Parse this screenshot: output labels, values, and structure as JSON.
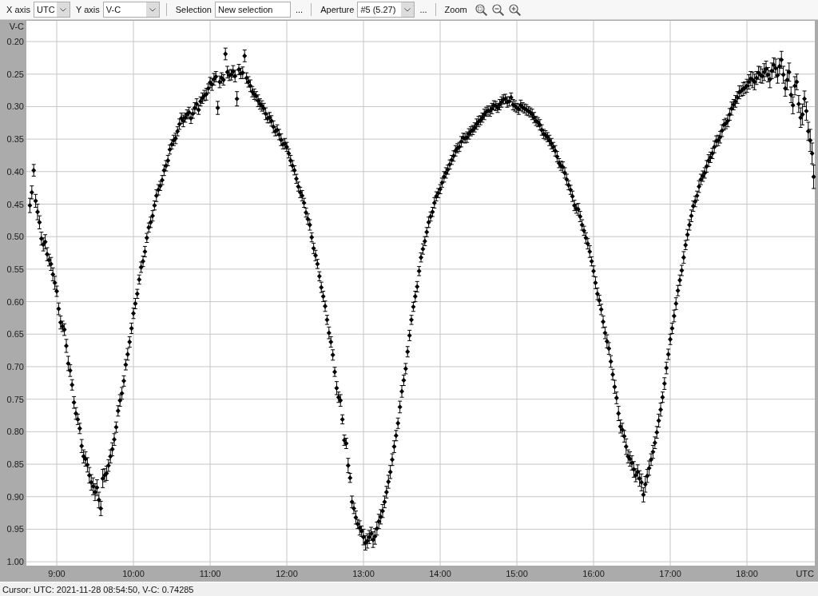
{
  "toolbar": {
    "groups": [
      [
        {
          "kind": "dropdown",
          "label": "X axis",
          "value": "UTC"
        },
        {
          "kind": "dropdown",
          "label": "Y axis",
          "value": "V-C"
        }
      ],
      [
        {
          "kind": "field",
          "label": "Selection",
          "value": "New selection",
          "button": "..."
        }
      ],
      [
        {
          "kind": "dropdown",
          "label": "Aperture",
          "value": "#5 (5.27)",
          "button": "..."
        }
      ],
      [
        {
          "kind": "zoom",
          "label": "Zoom"
        }
      ]
    ]
  },
  "chart": {
    "chart_data": {
      "type": "scatter",
      "grid": true,
      "xlabel": "UTC",
      "ylabel": "V-C",
      "xlim": [
        8.604,
        18.885
      ],
      "ylim": [
        1.006,
        0.168
      ],
      "xticks": [
        {
          "value": 9,
          "label": "9:00"
        },
        {
          "value": 10,
          "label": "10:00"
        },
        {
          "value": 11,
          "label": "11:00"
        },
        {
          "value": 12,
          "label": "12:00"
        },
        {
          "value": 13,
          "label": "13:00"
        },
        {
          "value": 14,
          "label": "14:00"
        },
        {
          "value": 15,
          "label": "15:00"
        },
        {
          "value": 16,
          "label": "16:00"
        },
        {
          "value": 17,
          "label": "17:00"
        },
        {
          "value": 18,
          "label": "18:00"
        }
      ],
      "yticks": [
        {
          "value": 0.2,
          "label": "0.20"
        },
        {
          "value": 0.25,
          "label": "0.25"
        },
        {
          "value": 0.3,
          "label": "0.30"
        },
        {
          "value": 0.35,
          "label": "0.35"
        },
        {
          "value": 0.4,
          "label": "0.40"
        },
        {
          "value": 0.45,
          "label": "0.45"
        },
        {
          "value": 0.5,
          "label": "0.50"
        },
        {
          "value": 0.55,
          "label": "0.55"
        },
        {
          "value": 0.6,
          "label": "0.60"
        },
        {
          "value": 0.65,
          "label": "0.65"
        },
        {
          "value": 0.7,
          "label": "0.70"
        },
        {
          "value": 0.75,
          "label": "0.75"
        },
        {
          "value": 0.8,
          "label": "0.80"
        },
        {
          "value": 0.85,
          "label": "0.85"
        },
        {
          "value": 0.9,
          "label": "0.90"
        },
        {
          "value": 0.95,
          "label": "0.95"
        },
        {
          "value": 1.0,
          "label": "1.00"
        }
      ],
      "x": [
        8.65,
        8.7,
        8.75,
        8.8,
        8.85,
        8.9,
        8.95,
        9,
        9.05,
        9.1,
        9.15,
        9.2,
        9.25,
        9.3,
        9.35,
        9.4,
        9.45,
        9.5,
        9.55,
        9.6,
        9.65,
        9.7,
        9.75,
        9.8,
        9.85,
        9.9,
        9.95,
        10,
        10.05,
        10.1,
        10.15,
        10.2,
        10.25,
        10.3,
        10.35,
        10.4,
        10.45,
        10.5,
        10.55,
        10.6,
        10.65,
        10.7,
        10.75,
        10.8,
        10.85,
        10.9,
        10.95,
        11,
        11.05,
        11.1,
        11.15,
        11.2,
        11.25,
        11.3,
        11.35,
        11.4,
        11.45,
        11.5,
        11.55,
        11.6,
        11.65,
        11.7,
        11.75,
        11.8,
        11.85,
        11.9,
        11.95,
        12,
        12.05,
        12.1,
        12.15,
        12.2,
        12.25,
        12.3,
        12.35,
        12.4,
        12.45,
        12.5,
        12.55,
        12.6,
        12.65,
        12.7,
        12.75,
        12.8,
        12.85,
        12.9,
        12.95,
        13,
        13.05,
        13.1,
        13.15,
        13.2,
        13.25,
        13.3,
        13.35,
        13.4,
        13.45,
        13.5,
        13.55,
        13.6,
        13.65,
        13.7,
        13.75,
        13.8,
        13.85,
        13.9,
        13.95,
        14,
        14.05,
        14.1,
        14.15,
        14.2,
        14.25,
        14.3,
        14.35,
        14.4,
        14.45,
        14.5,
        14.55,
        14.6,
        14.65,
        14.7,
        14.75,
        14.8,
        14.85,
        14.9,
        14.95,
        15,
        15.05,
        15.1,
        15.15,
        15.2,
        15.25,
        15.3,
        15.35,
        15.4,
        15.45,
        15.5,
        15.55,
        15.6,
        15.65,
        15.7,
        15.75,
        15.8,
        15.85,
        15.9,
        15.95,
        16,
        16.05,
        16.1,
        16.15,
        16.2,
        16.25,
        16.3,
        16.35,
        16.4,
        16.45,
        16.5,
        16.55,
        16.6,
        16.65,
        16.7,
        16.75,
        16.8,
        16.85,
        16.9,
        16.95,
        17,
        17.05,
        17.1,
        17.15,
        17.2,
        17.25,
        17.3,
        17.35,
        17.4,
        17.45,
        17.5,
        17.55,
        17.6,
        17.65,
        17.7,
        17.75,
        17.8,
        17.85,
        17.9,
        17.95,
        18,
        18.05,
        18.1,
        18.15,
        18.2,
        18.25,
        18.3,
        18.35,
        18.4,
        18.45,
        18.5,
        18.55,
        18.6,
        18.65,
        18.7,
        18.75,
        18.8,
        18.85,
        18.87,
        8.675,
        8.725,
        8.775,
        8.825,
        8.875,
        8.925,
        8.975,
        9.025,
        9.075,
        9.125,
        9.175,
        9.225,
        9.275,
        9.325,
        9.375,
        9.425,
        9.475,
        9.525,
        9.575,
        9.625,
        9.675,
        9.725,
        9.775,
        9.825,
        9.875,
        9.925,
        9.975,
        10.025,
        10.075,
        10.125,
        10.175,
        10.225,
        10.275,
        10.325,
        10.375,
        10.425,
        10.475,
        10.525,
        10.575,
        10.625,
        10.675,
        10.725,
        10.775,
        10.825,
        10.875,
        10.925,
        10.975,
        11.025,
        11.075,
        11.125,
        11.175,
        11.225,
        11.275,
        11.325,
        11.375,
        11.425,
        11.475,
        11.525,
        11.575,
        11.625,
        11.675,
        11.725,
        11.775,
        11.825,
        11.875,
        11.925,
        11.975,
        12.025,
        12.075,
        12.125,
        12.175,
        12.225,
        12.275,
        12.325,
        12.375,
        12.425,
        12.475,
        12.525,
        12.575,
        12.625,
        12.675,
        12.725,
        12.775,
        12.825,
        12.875,
        12.925,
        12.975,
        13.025,
        13.075,
        13.125,
        13.175,
        13.225,
        13.275,
        13.325,
        13.375,
        13.425,
        13.475,
        13.525,
        13.575,
        13.625,
        13.675,
        13.725,
        13.775,
        13.825,
        13.875,
        13.925,
        13.975,
        14.025,
        14.075,
        14.125,
        14.175,
        14.225,
        14.275,
        14.325,
        14.375,
        14.425,
        14.475,
        14.525,
        14.575,
        14.625,
        14.675,
        14.725,
        14.775,
        14.825,
        14.875,
        14.925,
        14.975,
        15.025,
        15.075,
        15.125,
        15.175,
        15.225,
        15.275,
        15.325,
        15.375,
        15.425,
        15.475,
        15.525,
        15.575,
        15.625,
        15.675,
        15.725,
        15.775,
        15.825,
        15.875,
        15.925,
        15.975,
        16.025,
        16.075,
        16.125,
        16.175,
        16.225,
        16.275,
        16.325,
        16.375,
        16.425,
        16.475,
        16.525,
        16.575,
        16.625,
        16.675,
        16.725,
        16.775,
        16.825,
        16.875,
        16.925,
        16.975,
        17.025,
        17.075,
        17.125,
        17.175,
        17.225,
        17.275,
        17.325,
        17.375,
        17.425,
        17.475,
        17.525,
        17.575,
        17.625,
        17.675,
        17.725,
        17.775,
        17.825,
        17.875,
        17.925,
        17.975,
        18.025,
        18.075,
        18.125,
        18.175,
        18.225,
        18.275,
        18.325,
        18.375,
        18.425,
        18.475,
        18.525,
        18.575,
        18.625,
        18.675,
        18.725,
        18.775,
        18.825
      ],
      "series": [
        {
          "color": "#000000",
          "values": [
            0.452,
            0.398,
            0.462,
            0.503,
            0.508,
            0.536,
            0.558,
            0.584,
            0.632,
            0.643,
            0.695,
            0.728,
            0.772,
            0.795,
            0.838,
            0.851,
            0.878,
            0.893,
            0.905,
            0.872,
            0.864,
            0.838,
            0.812,
            0.768,
            0.741,
            0.697,
            0.662,
            0.618,
            0.588,
            0.547,
            0.523,
            0.486,
            0.468,
            0.437,
            0.422,
            0.398,
            0.383,
            0.358,
            0.349,
            0.327,
            0.322,
            0.312,
            0.318,
            0.302,
            0.305,
            0.287,
            0.281,
            0.263,
            0.258,
            0.302,
            0.256,
            0.219,
            0.252,
            0.246,
            0.288,
            0.249,
            0.222,
            0.262,
            0.277,
            0.284,
            0.296,
            0.303,
            0.318,
            0.322,
            0.338,
            0.343,
            0.358,
            0.362,
            0.383,
            0.398,
            0.423,
            0.437,
            0.463,
            0.482,
            0.518,
            0.542,
            0.578,
            0.607,
            0.648,
            0.682,
            0.733,
            0.752,
            0.813,
            0.852,
            0.908,
            0.932,
            0.948,
            0.962,
            0.968,
            0.957,
            0.961,
            0.938,
            0.922,
            0.893,
            0.862,
            0.823,
            0.787,
            0.738,
            0.703,
            0.652,
            0.608,
            0.577,
            0.532,
            0.507,
            0.478,
            0.462,
            0.438,
            0.427,
            0.408,
            0.397,
            0.382,
            0.368,
            0.362,
            0.348,
            0.347,
            0.338,
            0.332,
            0.323,
            0.317,
            0.308,
            0.307,
            0.298,
            0.302,
            0.293,
            0.288,
            0.292,
            0.297,
            0.302,
            0.298,
            0.303,
            0.307,
            0.312,
            0.322,
            0.328,
            0.342,
            0.347,
            0.357,
            0.368,
            0.387,
            0.393,
            0.412,
            0.428,
            0.452,
            0.458,
            0.482,
            0.502,
            0.523,
            0.553,
            0.588,
            0.612,
            0.648,
            0.672,
            0.712,
            0.748,
            0.792,
            0.807,
            0.838,
            0.848,
            0.867,
            0.872,
            0.897,
            0.868,
            0.843,
            0.817,
            0.783,
            0.747,
            0.702,
            0.658,
            0.622,
            0.583,
            0.552,
            0.513,
            0.482,
            0.453,
            0.437,
            0.412,
            0.402,
            0.383,
            0.372,
            0.353,
            0.347,
            0.328,
            0.322,
            0.303,
            0.292,
            0.278,
            0.273,
            0.268,
            0.257,
            0.262,
            0.248,
            0.253,
            0.242,
            0.258,
            0.236,
            0.252,
            0.228,
            0.272,
            0.247,
            0.298,
            0.262,
            0.317,
            0.288,
            0.338,
            0.372,
            0.408,
            0.432,
            0.445,
            0.478,
            0.512,
            0.527,
            0.542,
            0.571,
            0.611,
            0.638,
            0.668,
            0.706,
            0.755,
            0.781,
            0.822,
            0.842,
            0.867,
            0.884,
            0.886,
            0.918,
            0.867,
            0.852,
            0.827,
            0.793,
            0.752,
            0.722,
            0.681,
            0.641,
            0.603,
            0.566,
            0.538,
            0.502,
            0.478,
            0.452,
            0.428,
            0.413,
            0.391,
            0.366,
            0.352,
            0.338,
            0.318,
            0.317,
            0.309,
            0.311,
            0.296,
            0.292,
            0.283,
            0.272,
            0.266,
            0.254,
            0.262,
            0.259,
            0.247,
            0.251,
            0.253,
            0.243,
            0.248,
            0.256,
            0.268,
            0.281,
            0.291,
            0.299,
            0.311,
            0.317,
            0.331,
            0.336,
            0.351,
            0.357,
            0.372,
            0.391,
            0.411,
            0.432,
            0.448,
            0.473,
            0.501,
            0.529,
            0.561,
            0.592,
            0.628,
            0.662,
            0.708,
            0.747,
            0.781,
            0.818,
            0.871,
            0.918,
            0.942,
            0.953,
            0.971,
            0.962,
            0.966,
            0.949,
            0.931,
            0.908,
            0.877,
            0.843,
            0.806,
            0.762,
            0.721,
            0.677,
            0.628,
            0.592,
            0.553,
            0.519,
            0.493,
            0.469,
            0.448,
            0.433,
            0.417,
            0.402,
            0.389,
            0.376,
            0.364,
            0.354,
            0.349,
            0.342,
            0.336,
            0.327,
            0.321,
            0.312,
            0.306,
            0.303,
            0.299,
            0.297,
            0.289,
            0.293,
            0.286,
            0.299,
            0.304,
            0.301,
            0.305,
            0.309,
            0.317,
            0.324,
            0.336,
            0.344,
            0.352,
            0.362,
            0.377,
            0.391,
            0.402,
            0.421,
            0.438,
            0.457,
            0.469,
            0.491,
            0.511,
            0.538,
            0.571,
            0.598,
            0.631,
            0.661,
            0.692,
            0.731,
            0.772,
            0.797,
            0.823,
            0.842,
            0.858,
            0.862,
            0.878,
            0.881,
            0.856,
            0.831,
            0.801,
            0.766,
            0.726,
            0.681,
            0.641,
            0.603,
            0.567,
            0.532,
            0.497,
            0.468,
            0.446,
            0.423,
            0.407,
            0.392,
            0.378,
            0.362,
            0.352,
            0.337,
            0.326,
            0.312,
            0.297,
            0.286,
            0.276,
            0.271,
            0.262,
            0.259,
            0.256,
            0.251,
            0.247,
            0.251,
            0.245,
            0.241,
            0.238,
            0.251,
            0.259,
            0.282,
            0.268,
            0.296,
            0.312,
            0.307,
            0.352
          ],
          "errors": [
            0.011,
            0.009,
            0.012,
            0.01,
            0.011,
            0.009,
            0.01,
            0.008,
            0.01,
            0.009,
            0.011,
            0.008,
            0.009,
            0.008,
            0.01,
            0.011,
            0.012,
            0.013,
            0.012,
            0.014,
            0.011,
            0.01,
            0.009,
            0.008,
            0.009,
            0.008,
            0.008,
            0.008,
            0.007,
            0.008,
            0.008,
            0.007,
            0.008,
            0.009,
            0.007,
            0.008,
            0.008,
            0.007,
            0.008,
            0.008,
            0.009,
            0.007,
            0.008,
            0.008,
            0.007,
            0.008,
            0.009,
            0.008,
            0.009,
            0.01,
            0.008,
            0.009,
            0.008,
            0.009,
            0.011,
            0.008,
            0.009,
            0.008,
            0.008,
            0.007,
            0.008,
            0.008,
            0.007,
            0.008,
            0.007,
            0.008,
            0.007,
            0.007,
            0.008,
            0.007,
            0.007,
            0.008,
            0.007,
            0.008,
            0.008,
            0.007,
            0.008,
            0.008,
            0.009,
            0.008,
            0.01,
            0.009,
            0.008,
            0.011,
            0.009,
            0.01,
            0.011,
            0.012,
            0.011,
            0.01,
            0.012,
            0.011,
            0.01,
            0.009,
            0.01,
            0.009,
            0.008,
            0.009,
            0.008,
            0.008,
            0.007,
            0.008,
            0.007,
            0.007,
            0.008,
            0.007,
            0.007,
            0.007,
            0.008,
            0.007,
            0.007,
            0.008,
            0.007,
            0.007,
            0.008,
            0.007,
            0.007,
            0.008,
            0.007,
            0.007,
            0.008,
            0.007,
            0.007,
            0.008,
            0.007,
            0.007,
            0.008,
            0.007,
            0.008,
            0.007,
            0.007,
            0.008,
            0.007,
            0.008,
            0.007,
            0.007,
            0.008,
            0.008,
            0.007,
            0.008,
            0.008,
            0.007,
            0.008,
            0.009,
            0.008,
            0.008,
            0.009,
            0.008,
            0.009,
            0.008,
            0.009,
            0.009,
            0.008,
            0.009,
            0.01,
            0.009,
            0.01,
            0.011,
            0.01,
            0.012,
            0.011,
            0.01,
            0.009,
            0.009,
            0.01,
            0.008,
            0.009,
            0.008,
            0.009,
            0.008,
            0.008,
            0.007,
            0.008,
            0.008,
            0.007,
            0.008,
            0.008,
            0.009,
            0.008,
            0.008,
            0.009,
            0.008,
            0.009,
            0.01,
            0.009,
            0.01,
            0.01,
            0.01,
            0.011,
            0.012,
            0.01,
            0.011,
            0.012,
            0.013,
            0.011,
            0.012,
            0.013,
            0.012,
            0.014,
            0.013,
            0.012,
            0.015,
            0.012,
            0.014,
            0.016,
            0.018,
            0.01,
            0.01,
            0.01,
            0.01,
            0.01,
            0.01,
            0.01,
            0.009,
            0.008,
            0.01,
            0.009,
            0.009,
            0.008,
            0.01,
            0.011,
            0.012,
            0.013,
            0.012,
            0.011,
            0.01,
            0.009,
            0.01,
            0.008,
            0.009,
            0.008,
            0.009,
            0.008,
            0.008,
            0.007,
            0.008,
            0.007,
            0.008,
            0.007,
            0.008,
            0.007,
            0.008,
            0.007,
            0.008,
            0.007,
            0.008,
            0.007,
            0.008,
            0.007,
            0.008,
            0.007,
            0.008,
            0.007,
            0.009,
            0.008,
            0.009,
            0.008,
            0.009,
            0.008,
            0.009,
            0.008,
            0.009,
            0.008,
            0.009,
            0.008,
            0.009,
            0.008,
            0.009,
            0.008,
            0.009,
            0.008,
            0.009,
            0.008,
            0.007,
            0.008,
            0.007,
            0.008,
            0.007,
            0.008,
            0.007,
            0.008,
            0.007,
            0.008,
            0.007,
            0.008,
            0.007,
            0.008,
            0.007,
            0.008,
            0.007,
            0.008,
            0.007,
            0.008,
            0.011,
            0.01,
            0.012,
            0.01,
            0.011,
            0.009,
            0.01,
            0.009,
            0.008,
            0.009,
            0.008,
            0.008,
            0.007,
            0.008,
            0.007,
            0.008,
            0.007,
            0.007,
            0.008,
            0.007,
            0.007,
            0.008,
            0.007,
            0.008,
            0.007,
            0.008,
            0.007,
            0.008,
            0.007,
            0.008,
            0.007,
            0.008,
            0.007,
            0.008,
            0.007,
            0.008,
            0.007,
            0.008,
            0.007,
            0.008,
            0.008,
            0.007,
            0.008,
            0.007,
            0.008,
            0.007,
            0.008,
            0.007,
            0.008,
            0.007,
            0.008,
            0.007,
            0.008,
            0.007,
            0.008,
            0.007,
            0.008,
            0.007,
            0.008,
            0.007,
            0.009,
            0.008,
            0.009,
            0.01,
            0.009,
            0.01,
            0.011,
            0.01,
            0.012,
            0.011,
            0.012,
            0.011,
            0.013,
            0.012,
            0.011,
            0.01,
            0.009,
            0.01,
            0.009,
            0.008,
            0.008,
            0.009,
            0.008,
            0.009,
            0.008,
            0.009,
            0.008,
            0.009,
            0.008,
            0.009,
            0.008,
            0.009,
            0.008,
            0.009,
            0.008,
            0.009,
            0.008,
            0.009,
            0.008,
            0.009,
            0.011,
            0.012,
            0.01,
            0.012,
            0.013,
            0.011,
            0.012,
            0.014,
            0.012,
            0.013,
            0.015,
            0.012,
            0.014,
            0.013,
            0.016,
            0.014,
            0.017
          ]
        }
      ]
    }
  },
  "status_bar": {
    "text": "Cursor: UTC: 2021-11-28 08:54:50, V-C: 0.74285"
  }
}
